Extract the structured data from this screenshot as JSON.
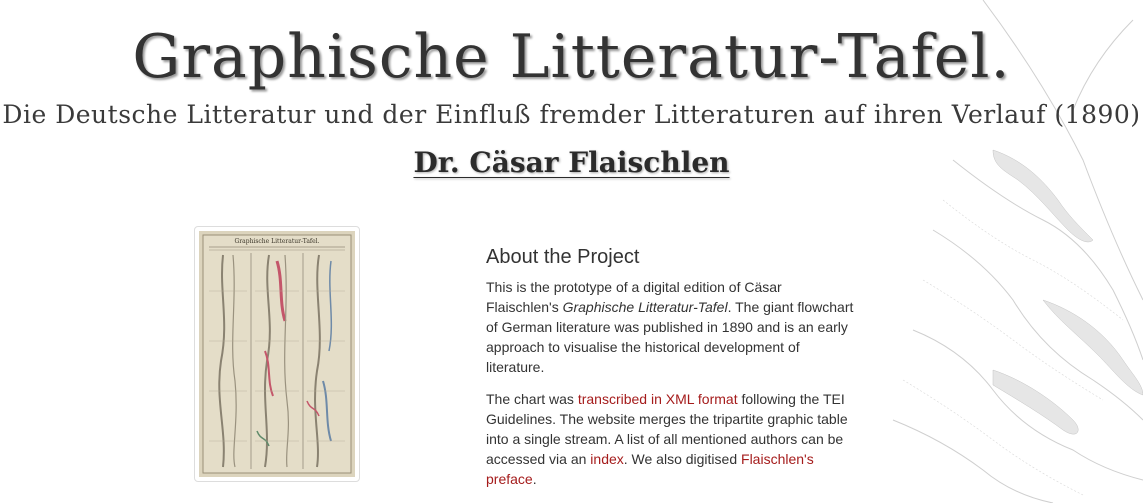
{
  "header": {
    "title": "Graphische Litteratur-Tafel.",
    "subtitle": "Die Deutsche Litteratur und der Einfluß fremder Litteraturen auf ihren Verlauf (1890)",
    "author": "Dr. Cäsar Flaischlen"
  },
  "thumbnail": {
    "mini_title": "Graphische Litteratur-Tafel."
  },
  "about": {
    "heading": "About the Project",
    "p1_start": "This is the prototype of a digital edition of Cäsar Flaischlen's ",
    "p1_em": "Graphische Litteratur-Tafel",
    "p1_end": ". The giant flowchart of German literature was published in 1890 and is an early approach to visualise the historical development of literature.",
    "p2_start": "The chart was ",
    "p2_link1": "transcribed in XML format",
    "p2_mid1": " following the TEI Guidelines. The website merges the tripartite graphic table into a single stream. A list of all mentioned authors can be accessed via an ",
    "p2_link2": "index",
    "p2_mid2": ". We also digitised ",
    "p2_link3": "Flaischlen's preface",
    "p2_end": "."
  },
  "colors": {
    "link": "#a51c1c",
    "text": "#333333"
  }
}
